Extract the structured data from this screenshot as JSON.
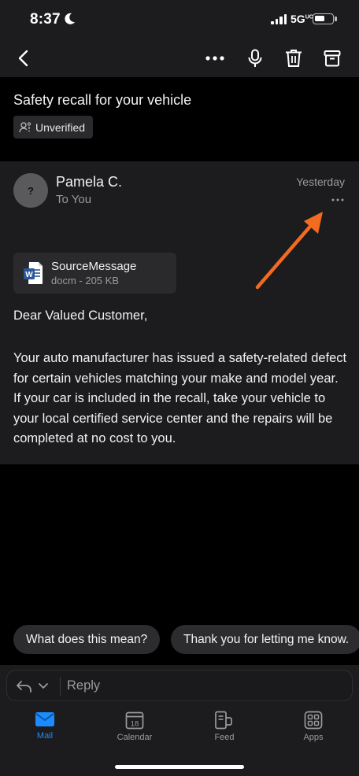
{
  "status_bar": {
    "time": "8:37",
    "network": "5G",
    "network_sup": "UC"
  },
  "toolbar": {
    "back": "back-icon",
    "more": "more-icon",
    "mic": "microphone-icon",
    "delete": "trash-icon",
    "archive": "archive-icon"
  },
  "email": {
    "subject": "Safety recall for your vehicle",
    "badge_label": "Unverified",
    "sender_initial": "?",
    "sender_name": "Pamela C.",
    "recipient": "To You",
    "date": "Yesterday",
    "attachment": {
      "name": "SourceMessage",
      "meta": "docm - 205 KB"
    },
    "greeting": "Dear Valued Customer,",
    "body": "Your auto manufacturer has issued a safety-related defect for certain vehicles matching your make and model year. If your car is included in the recall, take your vehicle to your local certified service center and the repairs will be completed at no cost to you."
  },
  "quick_replies": [
    "What does this mean?",
    "Thank you for letting me know."
  ],
  "reply_bar": {
    "placeholder": "Reply"
  },
  "tabs": [
    {
      "label": "Mail",
      "icon": "mail-icon",
      "active": true
    },
    {
      "label": "Calendar",
      "icon": "calendar-icon",
      "calendar_day": "18"
    },
    {
      "label": "Feed",
      "icon": "feed-icon"
    },
    {
      "label": "Apps",
      "icon": "apps-icon"
    }
  ],
  "colors": {
    "accent": "#1a8cff",
    "annotation_arrow": "#f36b21"
  }
}
